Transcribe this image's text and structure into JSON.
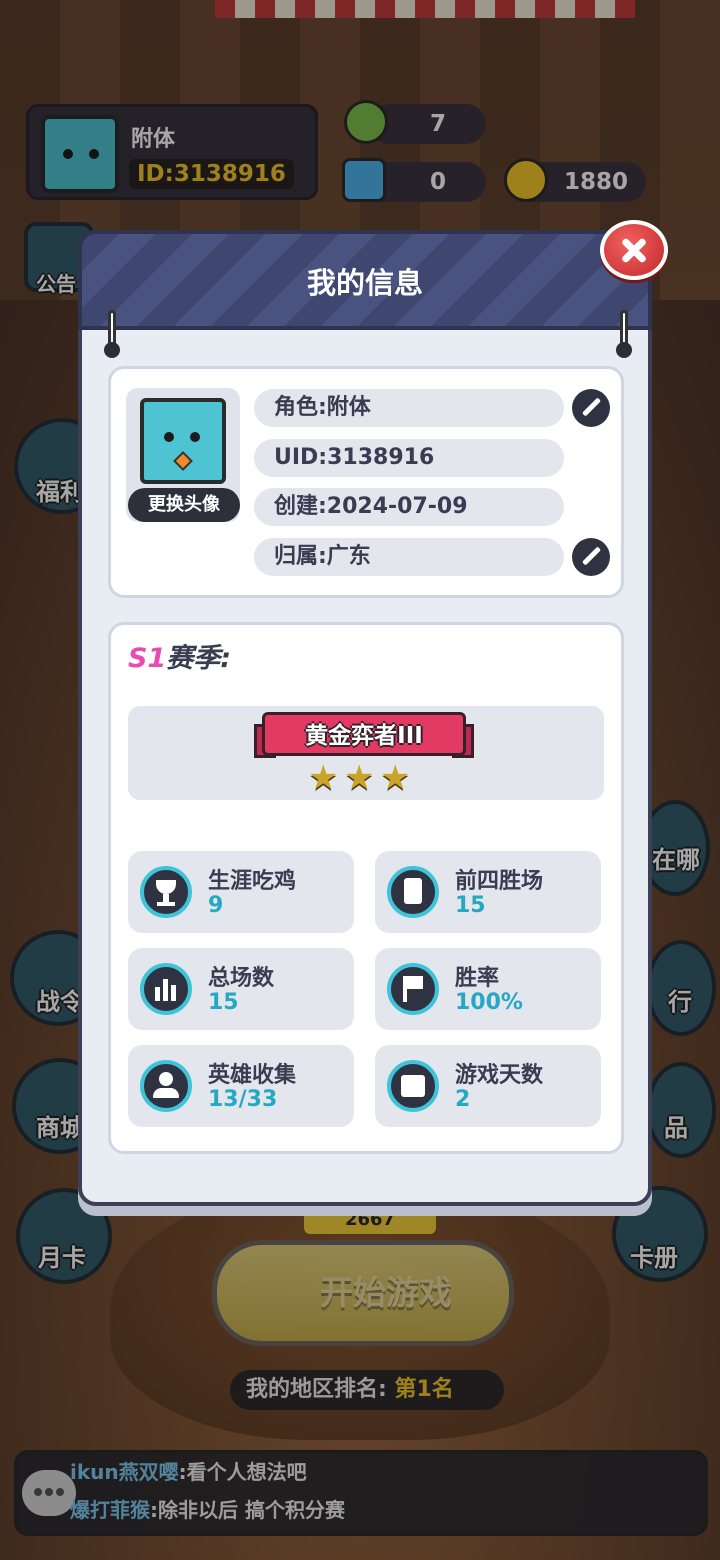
{
  "background": {
    "player": {
      "name": "附体",
      "id": "ID:3138916"
    },
    "resources": {
      "frog_count": "7",
      "diamonds": "0",
      "coins": "1880"
    },
    "side_buttons": [
      "公告",
      "福利",
      "战令",
      "商城",
      "月卡",
      "在哪",
      "行",
      "品",
      "卡册"
    ],
    "score_chip": "2667",
    "start_button": "开始游戏",
    "region_rank": {
      "label": "我的地区排名:",
      "value": "第1名"
    },
    "chat": [
      {
        "user": "ikun燕双嘤",
        "message": ":看个人想法吧"
      },
      {
        "user": "爆打菲猴",
        "message": ":除非以后 搞个积分赛"
      }
    ]
  },
  "modal": {
    "title": "我的信息",
    "profile": {
      "change_avatar": "更换头像",
      "role": "角色:附体",
      "uid": "UID:3138916",
      "created": "创建:2024-07-09",
      "region": "归属:广东"
    },
    "season": {
      "prefix": "S1",
      "suffix": "赛季:",
      "rank_name": "黄金弈者III",
      "stars": 3
    },
    "stats": [
      {
        "label": "生涯吃鸡",
        "value": "9",
        "icon": "trophy-icon"
      },
      {
        "label": "前四胜场",
        "value": "15",
        "icon": "clipboard-icon"
      },
      {
        "label": "总场数",
        "value": "15",
        "icon": "bar-chart-icon"
      },
      {
        "label": "胜率",
        "value": "100%",
        "icon": "flag-icon"
      },
      {
        "label": "英雄收集",
        "value": "13/33",
        "icon": "person-icon"
      },
      {
        "label": "游戏天数",
        "value": "2",
        "icon": "calendar-icon"
      }
    ]
  },
  "colors": {
    "accent": "#3ec4d8",
    "header": "#3f4770",
    "season_prefix": "#e84bb4",
    "rank_ribbon": "#e33a63",
    "gold": "#f4c62c"
  }
}
